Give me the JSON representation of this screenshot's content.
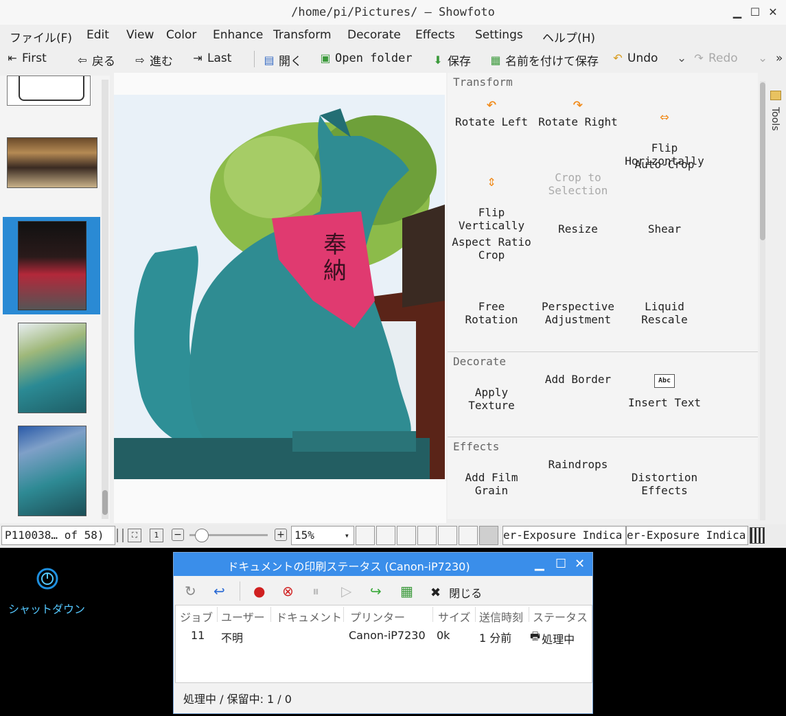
{
  "window": {
    "title": "/home/pi/Pictures/ — Showfoto"
  },
  "menu": [
    "ファイル(F)",
    "Edit",
    "View",
    "Color",
    "Enhance",
    "Transform",
    "Decorate",
    "Effects",
    "Settings",
    "ヘルプ(H)"
  ],
  "toolbar": {
    "first": "First",
    "back": "戻る",
    "forward": "進む",
    "last": "Last",
    "open": "開く",
    "open_folder": "Open folder",
    "save": "保存",
    "save_as": "名前を付けて保存",
    "undo": "Undo",
    "redo": "Redo"
  },
  "tools": {
    "transform": {
      "title": "Transform",
      "items": [
        "Rotate Left",
        "Rotate Right",
        "Flip\nHorizontally",
        "Flip\nVertically",
        "Crop to\nSelection",
        "Auto-Crop",
        "Aspect Ratio\nCrop",
        "Resize",
        "Shear",
        "Free\nRotation",
        "Perspective\nAdjustment",
        "Liquid\nRescale"
      ]
    },
    "decorate": {
      "title": "Decorate",
      "items": [
        "Apply\nTexture",
        "Add Border",
        "Insert Text"
      ],
      "abc": "Abc"
    },
    "effects": {
      "title": "Effects",
      "items": [
        "Add Film\nGrain",
        "Raindrops",
        "Distortion\nEffects"
      ]
    },
    "sidetab": "Tools"
  },
  "statusbar": {
    "file": "P110038… of 58)",
    "zoom": "15%",
    "under_exposure": "er-Exposure Indica",
    "over_exposure": "er-Exposure Indica"
  },
  "desktop": {
    "shutdown_label": "シャットダウン"
  },
  "print_dialog": {
    "title": "ドキュメントの印刷ステータス (Canon-iP7230)",
    "close_label": "閉じる",
    "columns": [
      "ジョブ",
      "ユーザー",
      "ドキュメント",
      "プリンター",
      "サイズ",
      "送信時刻",
      "ステータス"
    ],
    "row": {
      "job": "11",
      "user": "不明",
      "document": "",
      "printer": "Canon-iP7230",
      "size": "0k",
      "time": "1 分前",
      "status": "処理中"
    },
    "status_line": "処理中 / 保留中: 1 / 0"
  }
}
